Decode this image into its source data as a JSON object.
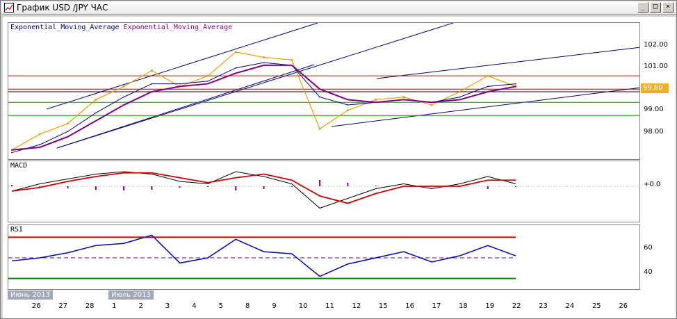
{
  "window": {
    "title": "График USD /JPY  ЧАС",
    "colors": {
      "title_bg": "#ffffff",
      "frame": "#d4d0c8"
    }
  },
  "panels": {
    "price": {
      "indicator_labels": [
        "Exponential_Moving_Average",
        "Exponential_Moving_Average"
      ],
      "y_ticks": [
        "102.00",
        "101.00",
        "100.00",
        "99.00",
        "98.00"
      ],
      "current_price": "99.80"
    },
    "macd": {
      "label": "MACD",
      "y_ticks": [
        "+0.0"
      ]
    },
    "rsi": {
      "label": "RSI",
      "y_ticks": [
        "60",
        "40"
      ]
    }
  },
  "x_axis": {
    "month_tags": [
      "Июнь 2013",
      "Июль 2013"
    ],
    "dates": [
      "26",
      "27",
      "28",
      "1",
      "2",
      "3",
      "4",
      "5",
      "8",
      "9",
      "10",
      "11",
      "12",
      "15",
      "16",
      "17",
      "18",
      "19",
      "22",
      "23",
      "24",
      "25",
      "26"
    ]
  },
  "chart_data": {
    "type": "line",
    "title": "График USD /JPY  ЧАС",
    "x": [
      "26",
      "27",
      "28",
      "1",
      "2",
      "3",
      "4",
      "5",
      "8",
      "9",
      "10",
      "11",
      "12",
      "15",
      "16",
      "17",
      "18",
      "19",
      "22"
    ],
    "series": [
      {
        "name": "USD/JPY",
        "values": [
          97.7,
          98.3,
          98.7,
          99.6,
          100.1,
          100.7,
          100.1,
          100.5,
          101.4,
          101.2,
          101.1,
          98.5,
          99.2,
          99.6,
          99.7,
          99.4,
          99.9,
          100.5,
          100.1
        ]
      },
      {
        "name": "Exponential_Moving_Average",
        "values": [
          97.6,
          97.9,
          98.4,
          99.1,
          99.7,
          100.2,
          100.2,
          100.3,
          100.8,
          101.0,
          100.9,
          99.7,
          99.4,
          99.5,
          99.6,
          99.5,
          99.7,
          100.1,
          100.2
        ]
      },
      {
        "name": "Exponential_Moving_Average",
        "values": [
          97.7,
          97.8,
          98.2,
          98.8,
          99.4,
          99.9,
          100.1,
          100.2,
          100.6,
          100.9,
          100.9,
          100.0,
          99.6,
          99.5,
          99.6,
          99.5,
          99.6,
          99.9,
          100.1
        ]
      }
    ],
    "ylim": [
      97.3,
      102.5
    ],
    "horizontal_levels": [
      100.5,
      100.0,
      99.9,
      99.5,
      99.0
    ],
    "macd_series": [
      -0.2,
      0.1,
      0.3,
      0.5,
      0.6,
      0.5,
      0.2,
      0.1,
      0.6,
      0.4,
      0.1,
      -0.9,
      -0.5,
      -0.1,
      0.1,
      -0.1,
      0.1,
      0.4,
      0.1
    ],
    "rsi_series": [
      47,
      50,
      55,
      62,
      64,
      72,
      45,
      50,
      68,
      56,
      54,
      32,
      44,
      50,
      56,
      46,
      52,
      62,
      52
    ],
    "rsi_levels": [
      70,
      50,
      30
    ]
  }
}
